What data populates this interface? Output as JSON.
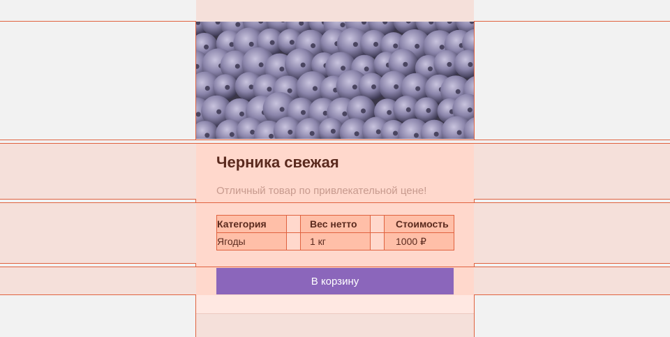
{
  "product": {
    "image_alt": "Blueberries",
    "title": "Черника свежая",
    "subtitle": "Отличный товар по привлекательной цене!"
  },
  "specs": {
    "headers": [
      "Категория",
      "Вес нетто",
      "Стоимость"
    ],
    "values": [
      "Ягоды",
      "1 кг",
      "1000 ₽"
    ]
  },
  "cart_button": {
    "label": "В корзину"
  },
  "colors": {
    "accent": "#8b66bb",
    "title": "#5a2a1e",
    "subtitle": "#c79a8e",
    "guide": "#e0623f"
  }
}
